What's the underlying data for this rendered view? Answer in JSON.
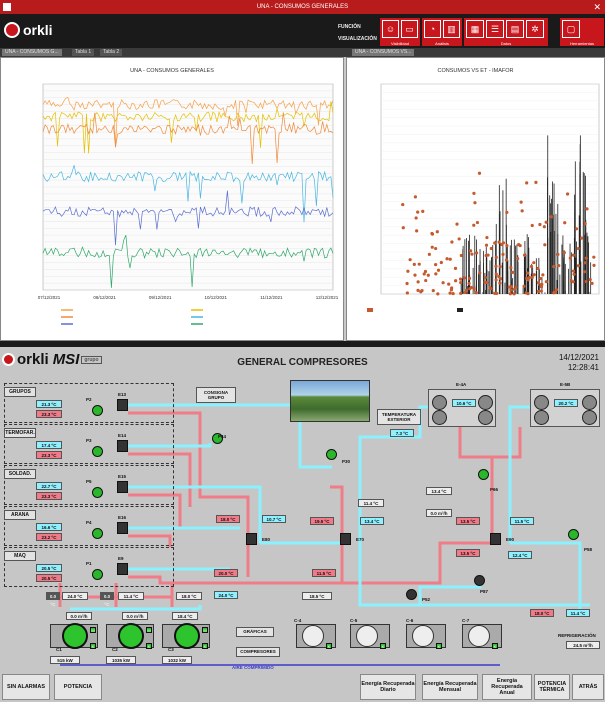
{
  "window": {
    "title": "UNA - CONSUMOS GENERALES",
    "close": "✕"
  },
  "ribbon": {
    "logo": "orkli",
    "label1": "FUNCIÓN",
    "label2": "VISUALIZACIÓN",
    "groups": [
      {
        "label": "Visibilidad",
        "icons": [
          "user-icon",
          "monitor-icon"
        ]
      },
      {
        "label": "Análisis",
        "icons": [
          "pie-icon",
          "bar-icon"
        ]
      },
      {
        "label": "Datos",
        "icons": [
          "table-icon",
          "list-icon",
          "grid-icon",
          "gear-icon"
        ]
      },
      {
        "label": "Herramientas",
        "icons": [
          "window-icon"
        ]
      }
    ]
  },
  "tabs": {
    "left": [
      "UNA - CONSUMOS G...",
      "Tabla 1",
      "Tabla 2"
    ],
    "right": [
      "UNA - CONSUMOS VS..."
    ]
  },
  "chart_left": {
    "title": "UNA - CONSUMOS GENERALES"
  },
  "chart_right": {
    "title": "CONSUMOS VS ET - IMAFOR"
  },
  "chart_data": [
    {
      "type": "line",
      "title": "UNA - CONSUMOS GENERALES",
      "x": [
        "07/12/2021",
        "08/12/2021",
        "09/12/2021",
        "10/12/2021",
        "11/12/2021",
        "12/12/2021"
      ],
      "series_colors": [
        "#f7a04a",
        "#e6c000",
        "#f08a3a",
        "#49b6e0",
        "#5b6fd0",
        "#2fa86a"
      ],
      "legend_position": "bottom"
    },
    {
      "type": "scatter",
      "title": "CONSUMOS VS ET - IMAFOR",
      "series_colors": [
        "#c45a2e",
        "#222222"
      ],
      "legend_position": "bottom"
    }
  ],
  "scada": {
    "logo": "orkli",
    "logo2": "MSI",
    "logo2_sub": "grupo",
    "title": "GENERAL COMPRESORES",
    "date": "14/12/2021",
    "time": "12:28:41",
    "groups": [
      {
        "label": "GRUPOS",
        "v1": "21.3 ºC",
        "v2": "23.3 ºC",
        "pump": "P2",
        "valve": "E13"
      },
      {
        "label": "TERMOFAR.",
        "v1": "17.4 ºC",
        "v2": "23.3 ºC",
        "pump": "P3",
        "valve": "E14"
      },
      {
        "label": "SOLDAD.",
        "v1": "22.7 ºC",
        "v2": "23.3 ºC",
        "pump": "P5",
        "valve": "E15"
      },
      {
        "label": "ARANA",
        "v1": "16.6 ºC",
        "v2": "23.2 ºC",
        "pump": "P4",
        "valve": "E16"
      },
      {
        "label": "MAQ",
        "v1": "20.5 ºC",
        "v2": "20.5 ºC",
        "pump": "P1",
        "valve": "E9"
      }
    ],
    "consigna_label": "CONSIGNA GRUPO",
    "temp_ext_label": "TEMPERATURA EXTERIOR",
    "temp_ext_value": "7.3 ºC",
    "fan_labels": [
      "E-4A",
      "E-5B"
    ],
    "fan_values": [
      "10.6 ºC",
      "20.2 ºC"
    ],
    "pumps": [
      "P44",
      "P30",
      "P66",
      "P52",
      "P87",
      "P58"
    ],
    "exchangers": [
      "E80",
      "E70",
      "E90"
    ],
    "readings": {
      "r1": "18.0 ºC",
      "r2": "10.7 ºC",
      "r3": "19.5 ºC",
      "r4": "13.4 ºC",
      "r5": "11.4 ºC",
      "r6": "13.4 ºC",
      "r7": "13.5 ºC",
      "r8": "11.5 ºC",
      "r9": "13.5 ºC",
      "r10": "12.4 ºC",
      "r11": "20.0 ºC",
      "r12": "11.5 ºC",
      "r13": "24.0 ºC",
      "r14": "24.0 ºC",
      "r15": "11.4 ºC",
      "r16": "18.0 ºC",
      "r17": "18.5 ºC",
      "r18": "18.0 ºC",
      "r19": "11.4 ºC",
      "r20": "0.0 m³/h",
      "r21": "0.0 m³/h",
      "r22": "18.4 ºC",
      "r23": "0.0 m³/h",
      "r24": "0.0 ºC",
      "r25": "0.0 ºC"
    },
    "btn_graficas": "GRÁFICAS",
    "btn_compresores": "COMPRESORES",
    "compressors": [
      "C1",
      "C2",
      "C3",
      "C-4",
      "C-5",
      "C-6",
      "C-7"
    ],
    "comp_values": [
      "515 kW",
      "1035 kW",
      "1032 kW"
    ],
    "air_label": "AIRE COMPRIMIDO",
    "refrig_label": "REFRIGERACIÓN",
    "refrig_value": "24.5 m³/h",
    "bottom": [
      "SIN ALARMAS",
      "POTENCIA",
      "Energía Recuperada Diario",
      "Energía Recuperada Mensual",
      "Energía Recuperada Anual",
      "POTENCIA TÉRMICA",
      "ATRÁS"
    ]
  }
}
